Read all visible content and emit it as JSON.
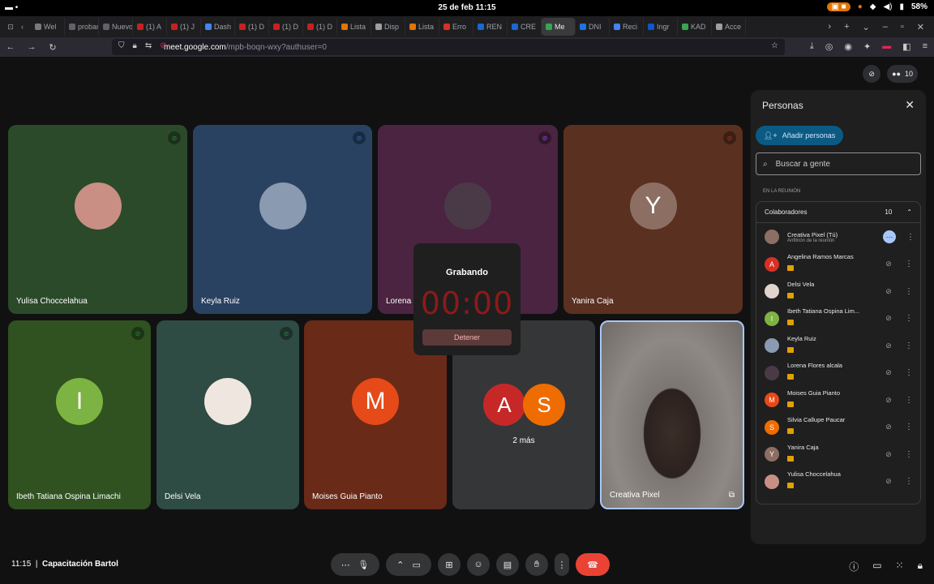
{
  "system": {
    "date": "25 de feb 11:15",
    "battery": "58%"
  },
  "tabs": [
    {
      "label": "Wel",
      "color": "#7a7a7a"
    },
    {
      "label": "probar-",
      "color": "#5f6368"
    },
    {
      "label": "Nuevo",
      "color": "#5f6368"
    },
    {
      "label": "(1) A",
      "color": "#c5221f"
    },
    {
      "label": "(1) J",
      "color": "#c5221f"
    },
    {
      "label": "Dash",
      "color": "#4285f4"
    },
    {
      "label": "(1) D",
      "color": "#c5221f"
    },
    {
      "label": "(1) D",
      "color": "#c5221f"
    },
    {
      "label": "(1) D",
      "color": "#c5221f"
    },
    {
      "label": "Lista",
      "color": "#e37400"
    },
    {
      "label": "Disp",
      "color": "#9e9e9e"
    },
    {
      "label": "Lista",
      "color": "#e37400"
    },
    {
      "label": "Erro",
      "color": "#d93025"
    },
    {
      "label": "REN",
      "color": "#1967d2"
    },
    {
      "label": "CRE",
      "color": "#1967d2"
    },
    {
      "label": "Me",
      "color": "#34a853"
    },
    {
      "label": "DNI",
      "color": "#1a73e8"
    },
    {
      "label": "Reci",
      "color": "#4285f4"
    },
    {
      "label": "Ingr",
      "color": "#0b57d0"
    },
    {
      "label": "KAD",
      "color": "#34a853"
    },
    {
      "label": "Acce",
      "color": "#9e9e9e"
    }
  ],
  "url": {
    "host": "meet.google.com",
    "path": "/mpb-boqn-wxy?authuser=0"
  },
  "participant_count": "10",
  "tiles": [
    {
      "name": "Yulisa Choccelahua",
      "bg": "#2b4a2a",
      "avatar": "photo",
      "initial": "",
      "avColor": "#c98f84",
      "micColor": "#1e8e3e"
    },
    {
      "name": "Keyla Ruiz",
      "bg": "#2a4262",
      "avatar": "photo",
      "initial": "",
      "avColor": "#8a9ab0",
      "micColor": "#1a73e8"
    },
    {
      "name": "Lorena",
      "bg": "#4a2440",
      "avatar": "photo",
      "initial": "",
      "avColor": "#4a3a48",
      "micColor": "#a142f4"
    },
    {
      "name": "Yanira Caja",
      "bg": "#5a3020",
      "avatar": "letter",
      "initial": "Y",
      "avColor": "#8d6e63",
      "micColor": "#c5221f"
    },
    {
      "name": "Ibeth Tatiana Ospina Limachi",
      "bg": "#2f5220",
      "avatar": "letter",
      "initial": "I",
      "avColor": "#7cb342",
      "micColor": "#1e8e3e"
    },
    {
      "name": "Delsi Vela",
      "bg": "#2e4b44",
      "avatar": "photo",
      "initial": "",
      "avColor": "#f0e6e0",
      "micColor": "#1e8e3e"
    },
    {
      "name": "Moises Guia Pianto",
      "bg": "#6a2a18",
      "avatar": "letter",
      "initial": "M",
      "avColor": "#e64a19",
      "micColor": ""
    },
    {
      "name": "",
      "bg": "#353638",
      "avatar": "group",
      "initial": "",
      "avColor": "",
      "micColor": ""
    },
    {
      "name": "Creativa Pixel",
      "bg": "#6e6a66",
      "avatar": "video",
      "initial": "",
      "avColor": "",
      "micColor": ""
    }
  ],
  "group_tile": {
    "a": "A",
    "s": "S",
    "more": "2 más"
  },
  "recording": {
    "title": "Grabando",
    "timer": "00:00",
    "stop": "Detener"
  },
  "panel": {
    "title": "Personas",
    "add_label": "Añadir personas",
    "search_placeholder": "Buscar a gente",
    "section": "EN LA REUNIÓN",
    "group": "Colaboradores",
    "group_count": "10",
    "people": [
      {
        "name": "Creativa Pixel (Tú)",
        "sub": "Anfitrión de la reunión",
        "initial": "",
        "color": "#8d6e63",
        "host": true
      },
      {
        "name": "Angelina Ramos Marcas",
        "sub": "",
        "initial": "A",
        "color": "#d93025",
        "host": false
      },
      {
        "name": "Delsi Vela",
        "sub": "",
        "initial": "",
        "color": "#e0d4cc",
        "host": false
      },
      {
        "name": "Ibeth Tatiana Ospina Lim...",
        "sub": "",
        "initial": "I",
        "color": "#7cb342",
        "host": false
      },
      {
        "name": "Keyla Ruiz",
        "sub": "",
        "initial": "",
        "color": "#8a9ab0",
        "host": false
      },
      {
        "name": "Lorena Flores alcala",
        "sub": "",
        "initial": "",
        "color": "#4a3a48",
        "host": false
      },
      {
        "name": "Moises Guia Pianto",
        "sub": "",
        "initial": "M",
        "color": "#e64a19",
        "host": false
      },
      {
        "name": "Silvia Callupe Paucar",
        "sub": "",
        "initial": "S",
        "color": "#ef6c00",
        "host": false
      },
      {
        "name": "Yanira Caja",
        "sub": "",
        "initial": "Y",
        "color": "#8d6e63",
        "host": false
      },
      {
        "name": "Yulisa Choccelahua",
        "sub": "",
        "initial": "",
        "color": "#c98f84",
        "host": false
      }
    ]
  },
  "bottom": {
    "time": "11:15",
    "separator": "|",
    "meeting": "Capacitación Bartol"
  }
}
